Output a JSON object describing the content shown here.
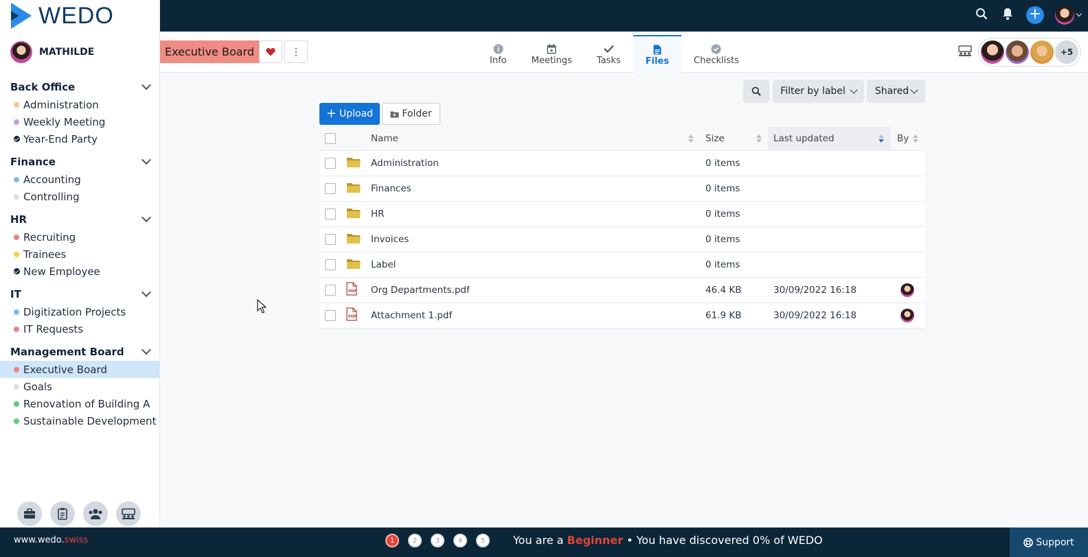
{
  "brand": {
    "name": "WEDO",
    "accent": "#1473d6",
    "footer_url_main": "www.wedo.",
    "footer_url_tld": "swiss"
  },
  "user": {
    "name": "MATHILDE"
  },
  "sidebar": {
    "groups": [
      {
        "title": "Back Office",
        "items": [
          {
            "label": "Administration",
            "color": "#f5c98a"
          },
          {
            "label": "Weekly Meeting",
            "color": "#c49be0"
          },
          {
            "label": "Year-End Party",
            "color": "check"
          }
        ]
      },
      {
        "title": "Finance",
        "items": [
          {
            "label": "Accounting",
            "color": "#7fbce8"
          },
          {
            "label": "Controlling",
            "color": "#dcdfe2"
          }
        ]
      },
      {
        "title": "HR",
        "items": [
          {
            "label": "Recruiting",
            "color": "#e8857c"
          },
          {
            "label": "Trainees",
            "color": "#f6d63a"
          },
          {
            "label": "New Employee",
            "color": "check"
          }
        ]
      },
      {
        "title": "IT",
        "items": [
          {
            "label": "Digitization Projects",
            "color": "#7fbce8"
          },
          {
            "label": "IT Requests",
            "color": "#e8857c"
          }
        ]
      },
      {
        "title": "Management Board",
        "items": [
          {
            "label": "Executive Board",
            "color": "#e8857c",
            "active": true
          },
          {
            "label": "Goals",
            "color": "#dcdfe2"
          },
          {
            "label": "Renovation of Building A",
            "color": "#5fcb7a"
          },
          {
            "label": "Sustainable Development",
            "color": "#5fcb7a"
          }
        ]
      }
    ]
  },
  "board": {
    "title": "Executive Board"
  },
  "tabs": [
    {
      "label": "Info"
    },
    {
      "label": "Meetings"
    },
    {
      "label": "Tasks"
    },
    {
      "label": "Files",
      "active": true
    },
    {
      "label": "Checklists"
    }
  ],
  "members": {
    "more_label": "+5"
  },
  "toolbar": {
    "filter_label": "Filter by label",
    "shared_label": "Shared",
    "upload_label": "Upload",
    "folder_label": "Folder"
  },
  "table": {
    "headers": {
      "name": "Name",
      "size": "Size",
      "last_updated": "Last updated",
      "by": "By"
    },
    "rows": [
      {
        "type": "folder",
        "name": "Administration",
        "size": "0 items",
        "updated": "",
        "by": false
      },
      {
        "type": "folder",
        "name": "Finances",
        "size": "0 items",
        "updated": "",
        "by": false
      },
      {
        "type": "folder",
        "name": "HR",
        "size": "0 items",
        "updated": "",
        "by": false
      },
      {
        "type": "folder",
        "name": "Invoices",
        "size": "0 items",
        "updated": "",
        "by": false
      },
      {
        "type": "folder",
        "name": "Label",
        "size": "0 items",
        "updated": "",
        "by": false
      },
      {
        "type": "pdf",
        "name": "Org Departments.pdf",
        "size": "46.4 KB",
        "updated": "30/09/2022 16:18",
        "by": true
      },
      {
        "type": "pdf",
        "name": "Attachment 1.pdf",
        "size": "61.9 KB",
        "updated": "30/09/2022 16:18",
        "by": true
      }
    ]
  },
  "footer": {
    "steps": [
      "1",
      "2",
      "3",
      "4",
      "5"
    ],
    "text_prefix": "You are a ",
    "level": "Beginner",
    "text_suffix": " • You have discovered 0% of WEDO",
    "support_label": "Support"
  }
}
